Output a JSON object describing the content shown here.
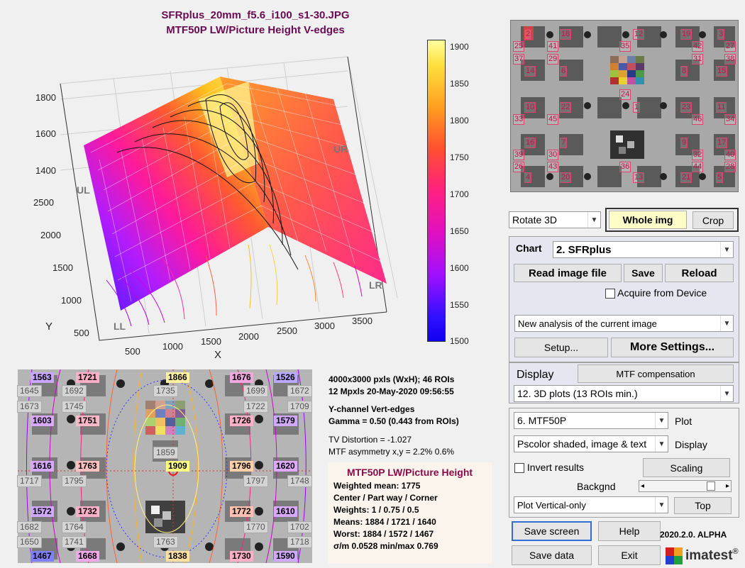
{
  "plot": {
    "title_line1": "SFRplus_20mm_f5.6_i100_s1-30.JPG",
    "title_line2": "MTF50P LW/Picture Height   V-edges",
    "z_ticks": [
      "1800",
      "1600",
      "1400"
    ],
    "y_ticks": [
      "2500",
      "2000",
      "1500",
      "1000",
      "500"
    ],
    "x_ticks": [
      "500",
      "1000",
      "1500",
      "2000",
      "2500",
      "3000",
      "3500"
    ],
    "x_label": "X",
    "y_label": "Y",
    "corner_ul": "UL",
    "corner_ur": "UR",
    "corner_ll": "LL",
    "corner_lr": "LR",
    "colorbar_ticks": [
      "1900",
      "1850",
      "1800",
      "1750",
      "1700",
      "1650",
      "1600",
      "1550",
      "1500"
    ]
  },
  "roi_map": {
    "numbers": [
      "2",
      "18",
      "12",
      "19",
      "3",
      "25",
      "41",
      "35",
      "42",
      "27",
      "37",
      "29",
      "31",
      "38",
      "14",
      "6",
      "8",
      "15",
      "24",
      "10",
      "22",
      "1",
      "23",
      "11",
      "33",
      "45",
      "46",
      "34",
      "16",
      "7",
      "9",
      "17",
      "39",
      "30",
      "32",
      "40",
      "26",
      "43",
      "36",
      "44",
      "28",
      "4",
      "20",
      "13",
      "21",
      "5"
    ]
  },
  "lower_map": {
    "labels_colored": [
      {
        "t": "1563",
        "c": "#c9a6ff"
      },
      {
        "t": "1721",
        "c": "#ffb0c8"
      },
      {
        "t": "1866",
        "c": "#fff0a0"
      },
      {
        "t": "1676",
        "c": "#f0a8e0"
      },
      {
        "t": "1526",
        "c": "#b8a8ff"
      },
      {
        "t": "1603",
        "c": "#d8a8ff"
      },
      {
        "t": "1751",
        "c": "#ffb8c8"
      },
      {
        "t": "1726",
        "c": "#ffb0c8"
      },
      {
        "t": "1579",
        "c": "#d0a8ff"
      },
      {
        "t": "1616",
        "c": "#d8a8ff"
      },
      {
        "t": "1763",
        "c": "#ffc0c0"
      },
      {
        "t": "1909",
        "c": "#ffff80"
      },
      {
        "t": "1796",
        "c": "#ffd0a8"
      },
      {
        "t": "1620",
        "c": "#e0a8ff"
      },
      {
        "t": "1572",
        "c": "#d0a8ff"
      },
      {
        "t": "1732",
        "c": "#ffb0c8"
      },
      {
        "t": "1772",
        "c": "#ffc0b0"
      },
      {
        "t": "1610",
        "c": "#d8a8ff"
      },
      {
        "t": "1467",
        "c": "#8080ff"
      },
      {
        "t": "1668",
        "c": "#f0a8e8"
      },
      {
        "t": "1838",
        "c": "#ffe0a0"
      },
      {
        "t": "1730",
        "c": "#ffb0c8"
      },
      {
        "t": "1590",
        "c": "#d0a8ff"
      }
    ],
    "labels_gray": [
      "1645",
      "1692",
      "1735",
      "1699",
      "1672",
      "1673",
      "1745",
      "1722",
      "1709",
      "1859",
      "1717",
      "1795",
      "1797",
      "1748",
      "1682",
      "1764",
      "1770",
      "1702",
      "1650",
      "1741",
      "1763",
      "1718"
    ]
  },
  "summary": {
    "line1": "4000x3000 pxls (WxH);   46 ROIs",
    "line2": "12 Mpxls   20-May-2020 09:56:55",
    "line3": "Y-channel   Vert-edges",
    "line4": "Gamma = 0.50  (0.443 from ROIs)",
    "line5": "TV Distortion = -1.027",
    "line6": "MTF asymmetry x,y = 2.2%  0.6%"
  },
  "results": {
    "title": "MTF50P LW/Picture Height",
    "weighted_mean": "Weighted mean: 1775",
    "zones": "Center / Part way / Corner",
    "weights": "Weights: 1 / 0.75 / 0.5",
    "means": "Means:      1884 / 1721 / 1640",
    "worst": "Worst:       1884 / 1572 / 1467",
    "sigma": "σ/m  0.0528   min/max  0.769"
  },
  "controls": {
    "rotate_select": "Rotate 3D",
    "whole_img": "Whole img",
    "crop": "Crop",
    "chart_label": "Chart",
    "chart_select": "2. SFRplus",
    "read_image_file": "Read image file",
    "save": "Save",
    "reload": "Reload",
    "acquire": "Acquire from Device",
    "analysis_select": "New analysis of the current image",
    "setup": "Setup...",
    "more_settings": "More Settings...",
    "display_label": "Display",
    "mtf_compensation": "MTF compensation",
    "display_select": "12. 3D plots (13 ROIs min.)",
    "plot_select": "6.  MTF50P",
    "plot_label": "Plot",
    "display_mode_select": "Pscolor shaded, image & text",
    "display_label2": "Display",
    "invert_results": "Invert results",
    "scaling": "Scaling",
    "backgnd": "Backgnd",
    "plot_vertical_select": "Plot Vertical-only",
    "top": "Top",
    "save_screen": "Save screen",
    "help": "Help",
    "version": "2020.2.0. ALPHA",
    "save_data": "Save data",
    "exit": "Exit",
    "brand": "imatest",
    "registered": "®"
  },
  "colors": {
    "title": "#6a0b54",
    "results_title": "#8a0a4a",
    "roi_number": "#c8104a"
  }
}
